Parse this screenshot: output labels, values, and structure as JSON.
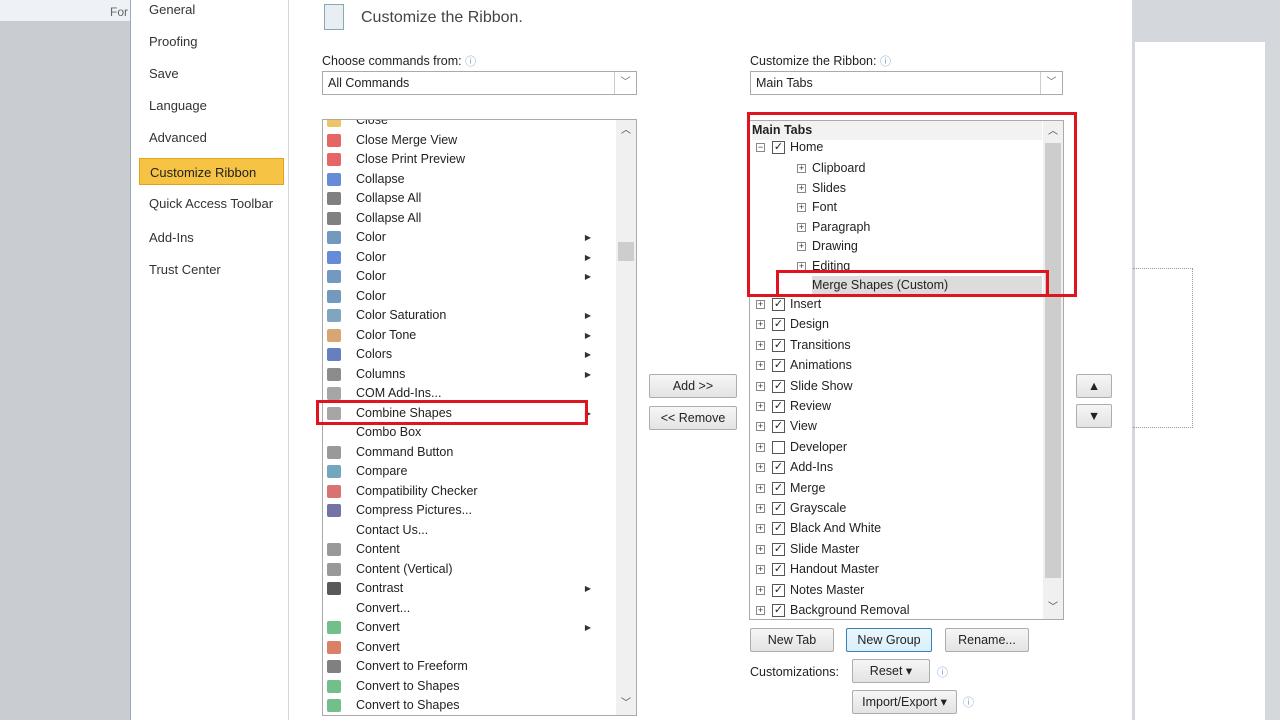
{
  "background": {
    "partial_label": "For"
  },
  "nav": {
    "items": [
      "General",
      "Proofing",
      "Save",
      "Language",
      "Advanced",
      "Customize Ribbon",
      "Quick Access Toolbar",
      "Add-Ins",
      "Trust Center"
    ],
    "selected": "Customize Ribbon"
  },
  "header": {
    "title": "Customize the Ribbon."
  },
  "left": {
    "label": "Choose commands from:",
    "combo_value": "All Commands",
    "commands": [
      {
        "t": "Close",
        "i": "folder-icon",
        "c": "#e8b030"
      },
      {
        "t": "Close Merge View",
        "i": "close-red-icon",
        "c": "#d33"
      },
      {
        "t": "Close Print Preview",
        "i": "close-red-icon",
        "c": "#d33"
      },
      {
        "t": "Collapse",
        "i": "collapse-icon",
        "c": "#36c"
      },
      {
        "t": "Collapse All",
        "i": "collapse-all-icon",
        "c": "#555"
      },
      {
        "t": "Collapse All",
        "i": "collapse-all-icon",
        "c": "#555"
      },
      {
        "t": "Color",
        "i": "color-icon",
        "c": "#47a",
        "s": true
      },
      {
        "t": "Color",
        "i": "pen-color-icon",
        "c": "#36c",
        "s": true
      },
      {
        "t": "Color",
        "i": "color-icon",
        "c": "#47a",
        "s": true
      },
      {
        "t": "Color",
        "i": "color-icon",
        "c": "#47a"
      },
      {
        "t": "Color Saturation",
        "i": "saturation-icon",
        "c": "#58a",
        "s": true
      },
      {
        "t": "Color Tone",
        "i": "tone-icon",
        "c": "#c84",
        "s": true
      },
      {
        "t": "Colors",
        "i": "colors-icon",
        "c": "#35a",
        "s": true
      },
      {
        "t": "Columns",
        "i": "columns-icon",
        "c": "#666",
        "s": true
      },
      {
        "t": "COM Add-Ins...",
        "i": "com-icon",
        "c": "#888"
      },
      {
        "t": "Combine Shapes",
        "i": "combine-shapes-icon",
        "c": "#888",
        "s": true
      },
      {
        "t": "Combo Box",
        "i": "",
        "c": ""
      },
      {
        "t": "Command Button",
        "i": "command-button-icon",
        "c": "#777"
      },
      {
        "t": "Compare",
        "i": "compare-icon",
        "c": "#48a"
      },
      {
        "t": "Compatibility Checker",
        "i": "compat-icon",
        "c": "#c44"
      },
      {
        "t": "Compress Pictures...",
        "i": "compress-icon",
        "c": "#448"
      },
      {
        "t": "Contact Us...",
        "i": "",
        "c": ""
      },
      {
        "t": "Content",
        "i": "content-icon",
        "c": "#777"
      },
      {
        "t": "Content (Vertical)",
        "i": "content-icon",
        "c": "#777"
      },
      {
        "t": "Contrast",
        "i": "contrast-icon",
        "c": "#222",
        "s": true
      },
      {
        "t": "Convert...",
        "i": "",
        "c": ""
      },
      {
        "t": "Convert",
        "i": "convert-icon",
        "c": "#4a6",
        "s": true
      },
      {
        "t": "Convert",
        "i": "convert-ppt-icon",
        "c": "#c53"
      },
      {
        "t": "Convert to Freeform",
        "i": "freeform-icon",
        "c": "#555"
      },
      {
        "t": "Convert to Shapes",
        "i": "shapes-icon",
        "c": "#4a6"
      },
      {
        "t": "Convert to Shapes",
        "i": "shapes-icon",
        "c": "#4a6"
      }
    ]
  },
  "buttons": {
    "add": "Add >>",
    "remove": "<< Remove",
    "new_tab": "New Tab",
    "new_group": "New Group",
    "rename": "Rename...",
    "reset": "Reset",
    "import_export": "Import/Export",
    "customizations": "Customizations:"
  },
  "right": {
    "label": "Customize the Ribbon:",
    "combo_value": "Main Tabs",
    "tree_header": "Main Tabs",
    "home": {
      "label": "Home",
      "checked": true,
      "groups": [
        "Clipboard",
        "Slides",
        "Font",
        "Paragraph",
        "Drawing",
        "Editing"
      ],
      "custom_group": "Merge Shapes (Custom)"
    },
    "tabs": [
      {
        "t": "Insert",
        "c": true
      },
      {
        "t": "Design",
        "c": true
      },
      {
        "t": "Transitions",
        "c": true
      },
      {
        "t": "Animations",
        "c": true
      },
      {
        "t": "Slide Show",
        "c": true
      },
      {
        "t": "Review",
        "c": true
      },
      {
        "t": "View",
        "c": true
      },
      {
        "t": "Developer",
        "c": false
      },
      {
        "t": "Add-Ins",
        "c": true
      },
      {
        "t": "Merge",
        "c": true
      },
      {
        "t": "Grayscale",
        "c": true
      },
      {
        "t": "Black And White",
        "c": true
      },
      {
        "t": "Slide Master",
        "c": true
      },
      {
        "t": "Handout Master",
        "c": true
      },
      {
        "t": "Notes Master",
        "c": true
      },
      {
        "t": "Background Removal",
        "c": true
      }
    ]
  },
  "colors": {
    "highlight": "#e0141e",
    "nav_selected": "#f6c344"
  }
}
